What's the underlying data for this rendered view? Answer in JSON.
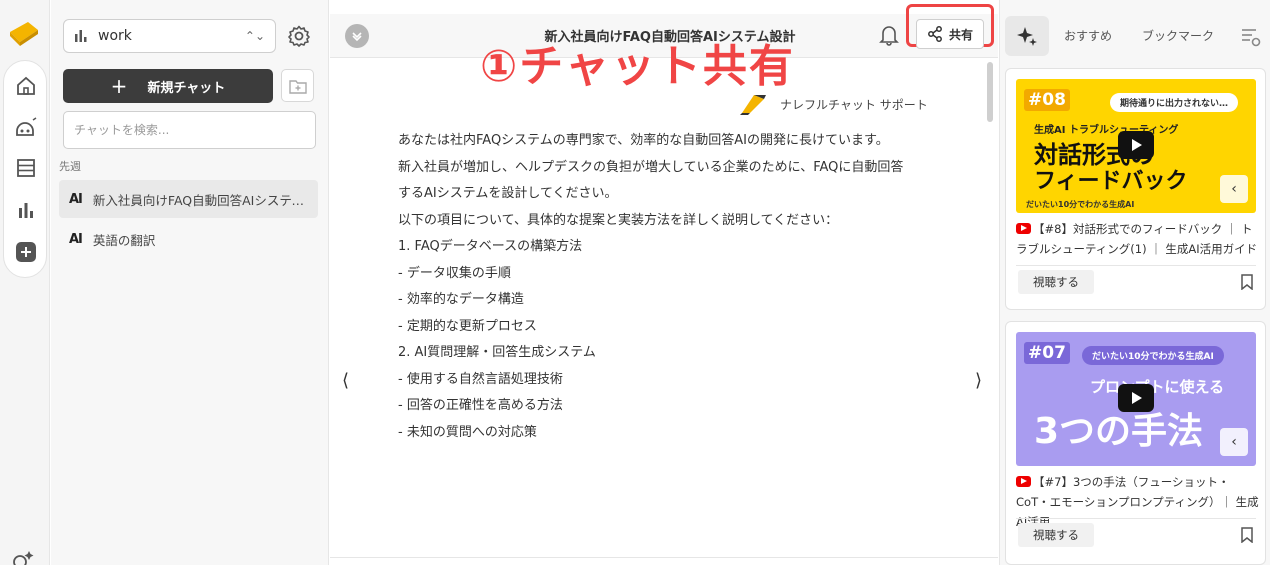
{
  "sidebar": {
    "workspace": "work",
    "new_chat_label": "新規チャット",
    "search_placeholder": "チャットを検索...",
    "section_label": "先週",
    "chats": [
      {
        "label": "新入社員向けFAQ自動回答AIシステム...",
        "icon": "AI"
      },
      {
        "label": "英語の翻訳",
        "icon": "AI"
      }
    ]
  },
  "header": {
    "title": "新入社員向けFAQ自動回答AIシステム設計",
    "share_label": "共有",
    "annotation": "①チャット共有"
  },
  "chat": {
    "brand": "ナレフルチャット サポート",
    "lines": [
      "あなたは社内FAQシステムの専門家で、効率的な自動回答AIの開発に長けています。",
      "新入社員が増加し、ヘルプデスクの負担が増大している企業のために、FAQに自動回答",
      "するAIシステムを設計してください。",
      "",
      "以下の項目について、具体的な提案と実装方法を詳しく説明してください：",
      "",
      "1. FAQデータベースの構築方法",
      "- データ収集の手順",
      "- 効率的なデータ構造",
      "- 定期的な更新プロセス",
      "",
      "2. AI質問理解・回答生成システム",
      "- 使用する自然言語処理技術",
      "- 回答の正確性を高める方法",
      "- 未知の質問への対応策"
    ],
    "prev_arrow": "⟨",
    "next_arrow": "⟩"
  },
  "right_panel": {
    "tabs": [
      "おすすめ",
      "ブックマーク"
    ],
    "cards": [
      {
        "number": "#08",
        "pill": "期待通りに出力されない…",
        "subtitle": "生成AI トラブルシューティング",
        "headline1": "対話形式の",
        "headline2": "フィードバック",
        "footer": "だいたい10分でわかる生成AI",
        "title": "【#8】対話形式でのフィードバック ｜ トラブルシューティング(1) ｜ 生成AI活用ガイド",
        "watch_label": "視聴する",
        "bg_color": "#ffd500"
      },
      {
        "number": "#07",
        "pill": "だいたい10分でわかる生成AI",
        "subtitle": "プロンプトに使える",
        "headline1": "3つの手法",
        "title": "【#7】3つの手法（フューショット・CoT・エモーションプロンプティング）｜ 生成AI活用...",
        "watch_label": "視聴する",
        "bg_color": "#a99cf0"
      }
    ]
  }
}
